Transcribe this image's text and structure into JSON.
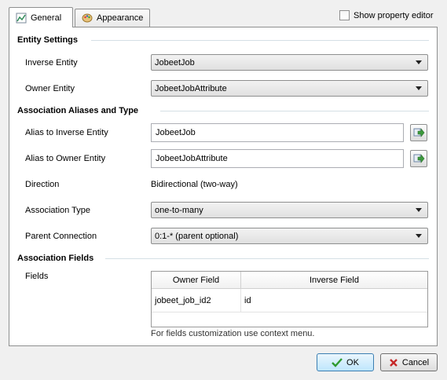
{
  "tabs": [
    {
      "label": "General",
      "icon": "general-chart-icon",
      "active": true
    },
    {
      "label": "Appearance",
      "icon": "palette-icon",
      "active": false
    }
  ],
  "show_property_editor": {
    "label": "Show property editor",
    "checked": false
  },
  "sections": {
    "entity_settings": "Entity Settings",
    "aliases": "Association Aliases and Type",
    "fields": "Association Fields"
  },
  "entity": {
    "inverse_label": "Inverse Entity",
    "inverse_value": "JobeetJob",
    "owner_label": "Owner Entity",
    "owner_value": "JobeetJobAttribute"
  },
  "alias": {
    "inverse_label": "Alias to Inverse Entity",
    "inverse_value": "JobeetJob",
    "owner_label": "Alias to Owner Entity",
    "owner_value": "JobeetJobAttribute",
    "direction_label": "Direction",
    "direction_value": "Bidirectional (two-way)",
    "type_label": "Association Type",
    "type_value": "one-to-many",
    "parent_label": "Parent Connection",
    "parent_value": "0:1-* (parent optional)"
  },
  "fields": {
    "label": "Fields",
    "columns": [
      "Owner Field",
      "Inverse Field"
    ],
    "rows": [
      [
        "jobeet_job_id2",
        "id"
      ]
    ],
    "hint": "For fields customization use context menu."
  },
  "buttons": {
    "ok": "OK",
    "cancel": "Cancel"
  },
  "colors": {
    "ok_check": "#2f9a2f",
    "cancel_x": "#c62828",
    "accent_arrow": "#3c9a3c"
  }
}
